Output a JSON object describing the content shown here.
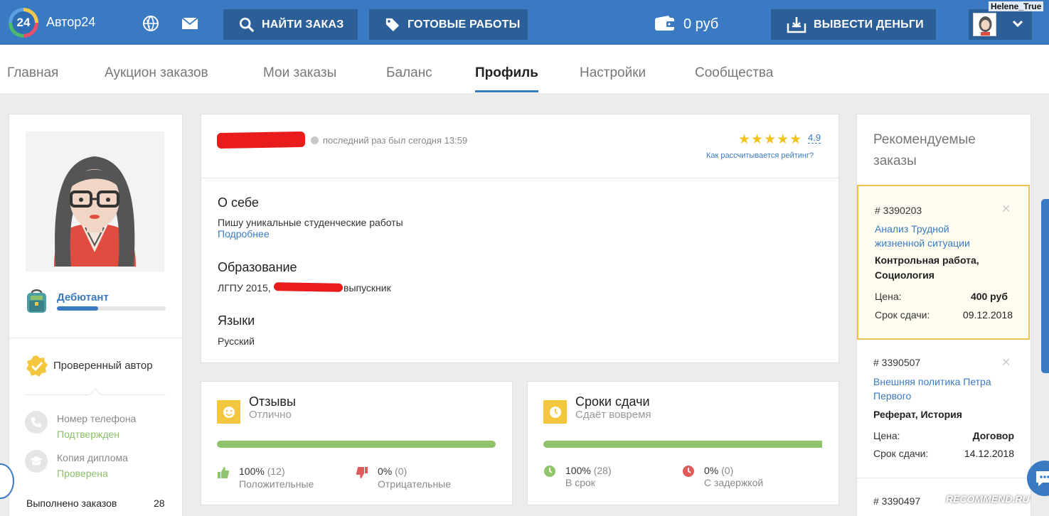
{
  "header": {
    "logo_number": "24",
    "logo_text": "Автор24",
    "find_order": "НАЙТИ ЗАКАЗ",
    "ready_works": "ГОТОВЫЕ РАБОТЫ",
    "balance": "0 руб",
    "withdraw": "ВЫВЕСТИ ДЕНЬГИ",
    "username": "Helene_True",
    "icons": [
      "globe-icon",
      "envelope-icon",
      "search-icon",
      "tag-icon",
      "wallet-icon",
      "download-icon",
      "chevron-down-icon"
    ]
  },
  "nav": {
    "items": [
      "Главная",
      "Аукцион заказов",
      "Мои заказы",
      "Баланс",
      "Профиль",
      "Настройки",
      "Сообщества"
    ],
    "active": "Профиль"
  },
  "sidebar": {
    "level": "Дебютант",
    "level_progress": 0.38,
    "verified": "Проверенный автор",
    "phone_label": "Номер телефона",
    "phone_status": "Подтвержден",
    "diploma_label": "Копия диплома",
    "diploma_status": "Проверена",
    "orders_done_label": "Выполнено заказов",
    "orders_done_value": "28"
  },
  "profile": {
    "last_seen": "последний раз был сегодня 13:59",
    "rating": "4.9",
    "rating_link": "Как рассчитывается рейтинг?",
    "about_title": "О себе",
    "about_text": "Пишу уникальные студенческие работы",
    "more_link": "Подробнее",
    "edu_title": "Образование",
    "edu_prefix": "ЛГПУ 2015,",
    "edu_suffix": "выпускник",
    "lang_title": "Языки",
    "lang_text": "Русский"
  },
  "reviews": {
    "title": "Отзывы",
    "subtitle": "Отлично",
    "positive_value": "100%",
    "positive_count": "(12)",
    "positive_label": "Положительные",
    "negative_value": "0%",
    "negative_count": "(0)",
    "negative_label": "Отрицательные"
  },
  "deadlines": {
    "title": "Сроки сдачи",
    "subtitle": "Сдаёт вовремя",
    "ontime_value": "100%",
    "ontime_count": "(28)",
    "ontime_label": "В срок",
    "late_value": "0%",
    "late_count": "(0)",
    "late_label": "С задержкой"
  },
  "recommended": {
    "title": "Рекомендуемые заказы",
    "orders": [
      {
        "number": "# 3390203",
        "title": "Анализ Трудной жизненной ситуации",
        "type": "Контрольная работа, Социология",
        "price_label": "Цена:",
        "price": "400 руб",
        "deadline_label": "Срок сдачи:",
        "deadline": "09.12.2018"
      },
      {
        "number": "# 3390507",
        "title": "Внешняя политика Петра Первого",
        "type": "Реферат, История",
        "price_label": "Цена:",
        "price": "Договор",
        "deadline_label": "Срок сдачи:",
        "deadline": "14.12.2018"
      },
      {
        "number": "# 3390497"
      }
    ]
  },
  "watermark": "RECOMMEND.RU",
  "colors": {
    "primary": "#3a7ac3",
    "dark_button": "#2c5f98",
    "green": "#8fc46a",
    "yellow": "#f3c73d",
    "highlight_border": "#f3c24d"
  }
}
